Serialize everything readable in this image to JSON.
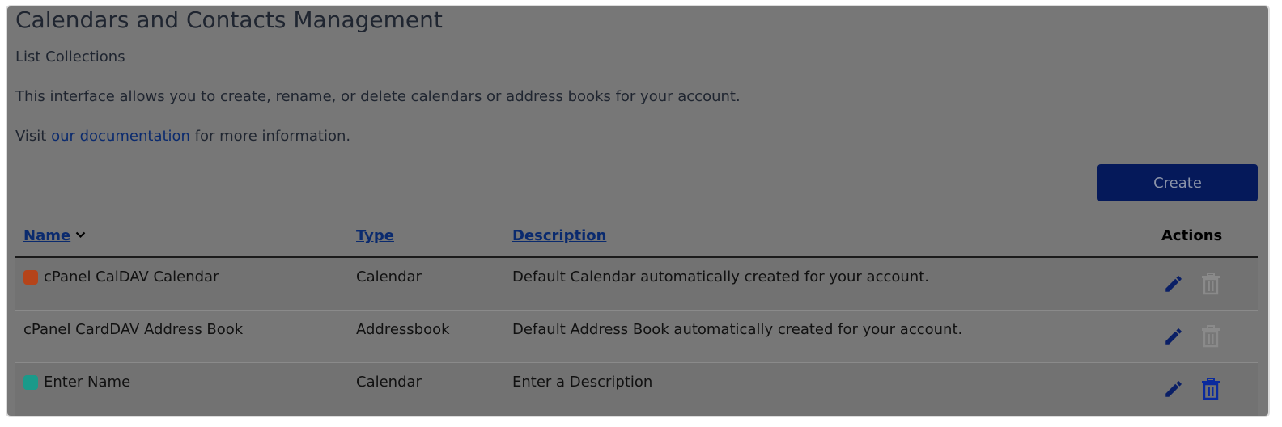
{
  "page": {
    "title": "Calendars and Contacts Management",
    "subtitle": "List Collections",
    "intro": "This interface allows you to create, rename, or delete calendars or address books for your account.",
    "visit_prefix": "Visit ",
    "doc_link": "our documentation",
    "visit_suffix": " for more information."
  },
  "toolbar": {
    "create_label": "Create"
  },
  "table": {
    "headers": {
      "name": "Name",
      "type": "Type",
      "description": "Description",
      "actions": "Actions"
    },
    "rows": [
      {
        "name": "cPanel CalDAV Calendar",
        "type": "Calendar",
        "description": "Default Calendar automatically created for your account.",
        "color": "#b5441a"
      },
      {
        "name": "cPanel CardDAV Address Book",
        "type": "Addressbook",
        "description": "Default Address Book automatically created for your account.",
        "color": ""
      },
      {
        "name": "Enter Name",
        "type": "Calendar",
        "description": "Enter a Description",
        "color": "#1a9a8a"
      }
    ]
  },
  "icons": {
    "edit": "pencil-icon",
    "delete": "trash-icon",
    "sort": "chevron-down-icon"
  },
  "colors": {
    "accent": "#05195a",
    "link": "#0a2a6e",
    "delete_disabled": "#8a8a8a",
    "delete_active": "#0a2a9e"
  }
}
